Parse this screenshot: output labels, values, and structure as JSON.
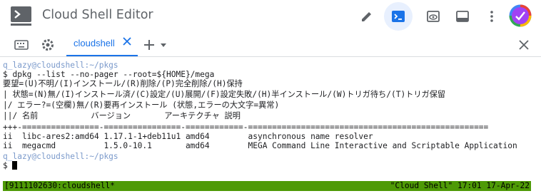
{
  "app": {
    "title": "Cloud Shell Editor"
  },
  "toolbar": {
    "icons": [
      "pencil-icon",
      "terminal-icon",
      "preview-icon",
      "panel-icon",
      "more-vert-icon",
      "avatar"
    ]
  },
  "tabs": {
    "items": [
      {
        "label": "cloudshell"
      }
    ]
  },
  "terminal": {
    "lines": [
      {
        "prompt": "q_lazy@cloudshell:~/pkgs",
        "text": ""
      },
      {
        "prompt": "",
        "text": "$ dpkg --list --no-pager --root=${HOME}/mega"
      },
      {
        "prompt": "",
        "text": "要望=(U)不明/(I)インストール/(R)削除/(P)完全削除/(H)保持"
      },
      {
        "prompt": "",
        "text": "| 状態=(N)無/(I)インストール済/(C)設定/(U)展開/(F)設定失敗/(H)半インストール/(W)トリガ待ち/(T)トリガ保留"
      },
      {
        "prompt": "",
        "text": "|/ エラー?=(空欄)無/(R)要再インストール (状態,エラーの大文字=異常)"
      },
      {
        "prompt": "",
        "text": "||/ 名前           バージョン       アーキテクチャ 説明"
      },
      {
        "prompt": "",
        "text": "+++-================-================-============-=================================================="
      },
      {
        "prompt": "",
        "text": "ii  libc-ares2:amd64 1.17.1-1+deb11u1 amd64        asynchronous name resolver"
      },
      {
        "prompt": "",
        "text": "ii  megacmd          1.5.0-10.1       amd64        MEGA Command Line Interactive and Scriptable Application"
      },
      {
        "prompt": "q_lazy@cloudshell:~/pkgs",
        "text": ""
      },
      {
        "prompt": "",
        "text": "$ "
      }
    ]
  },
  "status": {
    "left": "[9111102630:cloudshell*",
    "right": "\"Cloud Shell\" 17:01 17-Apr-22"
  },
  "colors": {
    "accent": "#1a73e8",
    "prompt": "#7b9acb",
    "status_bg": "#4e9a06"
  }
}
